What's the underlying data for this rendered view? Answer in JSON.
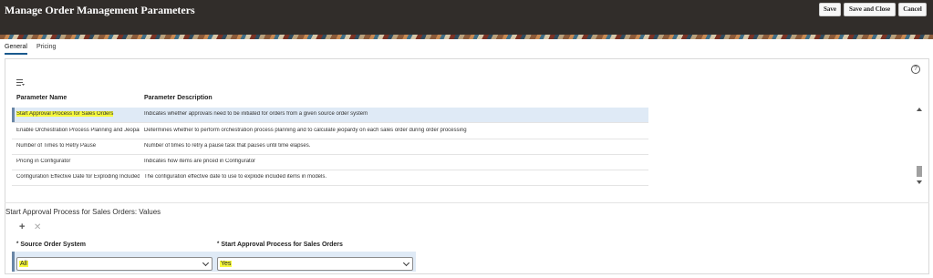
{
  "header": {
    "title": "Manage Order Management Parameters",
    "save_label": "Save",
    "save_close_label": "Save and Close",
    "cancel_label": "Cancel"
  },
  "tabs": [
    {
      "label": "General",
      "active": true
    },
    {
      "label": "Pricing",
      "active": false
    }
  ],
  "help_icon": "?",
  "table": {
    "columns": [
      "Parameter Name",
      "Parameter Description"
    ],
    "rows": [
      {
        "name": "Start Approval Process for Sales Orders",
        "description": "Indicates whether approvals need to be initiated for orders from a given source order system",
        "selected": true,
        "highlighted": true
      },
      {
        "name": "Enable Orchestration Process Planning and Jeopardy Calculation",
        "description": "Determines whether to perform orchestration process planning and to calculate jeopardy on each sales order during order processing"
      },
      {
        "name": "Number of Times to Retry Pause",
        "description": "Number of times to retry a pause task that pauses until time elapses."
      },
      {
        "name": "Pricing in Configurator",
        "description": "Indicates how items are priced in Configurator"
      },
      {
        "name": "Configuration Effective Date for Exploding Included Items",
        "description": "The configuration effective date to use to explode included items in models."
      }
    ]
  },
  "values_section": {
    "title": "Start Approval Process for Sales Orders: Values",
    "add_icon": "+",
    "delete_icon": "✕",
    "columns": [
      {
        "label": "Source Order System",
        "required_marker": "*"
      },
      {
        "label": "Start Approval Process for Sales Orders",
        "required_marker": "*"
      }
    ],
    "row": {
      "source_order_system": "All",
      "start_approval": "Yes"
    }
  },
  "colors": {
    "header_bg": "#312d2a",
    "selected_row_bg": "#dfeaf6",
    "highlight": "#f6f93a",
    "active_tab_underline": "#1a5a8e"
  }
}
